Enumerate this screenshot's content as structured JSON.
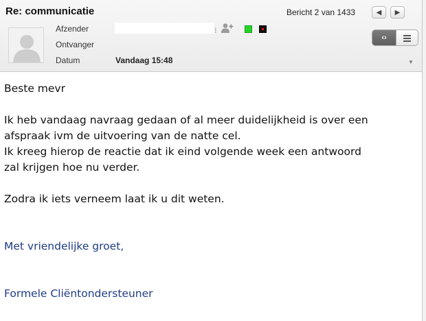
{
  "header": {
    "subject": "Re: communicatie",
    "counter": "Bericht 2 van 1433",
    "prev_icon": "triangle-left",
    "next_icon": "triangle-right",
    "fields": {
      "from_label": "Afzender",
      "to_label": "Ontvanger",
      "date_label": "Datum",
      "date_value": "Vandaag 15:48"
    },
    "view_toggle": {
      "html_icon": "code-brackets",
      "text_icon": "lines"
    },
    "colors": {
      "tag_green": "#28d428",
      "tag_black": "#111111",
      "tag_red_dot": "#e21919"
    }
  },
  "message": {
    "greeting": "Beste  mevr",
    "para1_line1": "Ik heb vandaag navraag gedaan of al meer duidelijkheid is over een",
    "para1_line2": "afspraak ivm de uitvoering van de natte cel.",
    "para1_line3": "Ik kreeg hierop de reactie dat ik eind volgende week een antwoord",
    "para1_line4": "zal krijgen hoe nu verder.",
    "para2": "Zodra ik iets verneem laat ik u dit weten.",
    "closing": "Met vriendelijke groet,",
    "signature": "Formele Cliëntondersteuner",
    "signature_color": "#1f3b84"
  }
}
